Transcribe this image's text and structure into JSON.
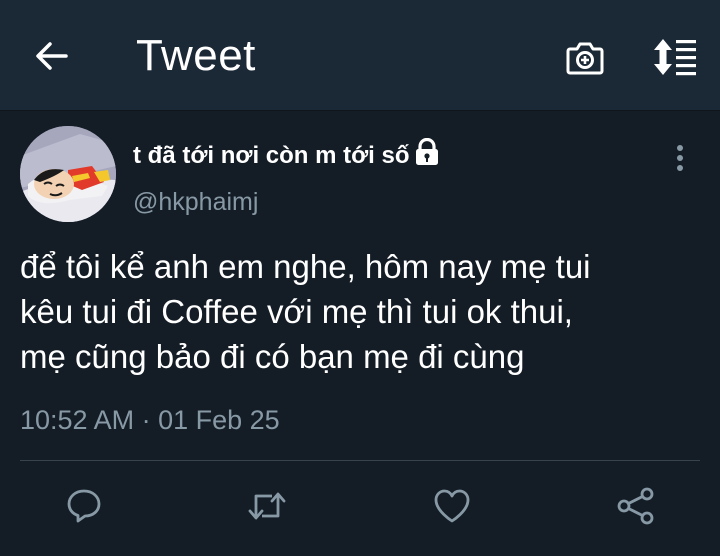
{
  "header": {
    "title": "Tweet",
    "back_icon": "arrow-left-icon",
    "camera_icon": "camera-plus-icon",
    "sort_icon": "sort-list-icon"
  },
  "tweet": {
    "author": {
      "display_name": "t đã tới nơi còn m tới số",
      "handle": "@hkphaimj",
      "protected_icon": "lock-icon",
      "avatar_icon": "avatar-cartoon-icon"
    },
    "text_lines": [
      "để tôi kể anh em nghe, hôm nay mẹ tui",
      "kêu tui đi Coffee với mẹ thì tui ok thui,",
      "mẹ cũng bảo đi có bạn mẹ đi cùng"
    ],
    "timestamp": "10:52 AM · 01 Feb 25",
    "actions": [
      "reply-icon",
      "retweet-icon",
      "like-icon",
      "share-icon"
    ]
  },
  "colors": {
    "background": "#141d26",
    "header_background": "#1b2836",
    "text": "#ffffff",
    "secondary_text": "#8899a6",
    "divider": "#38444d"
  }
}
